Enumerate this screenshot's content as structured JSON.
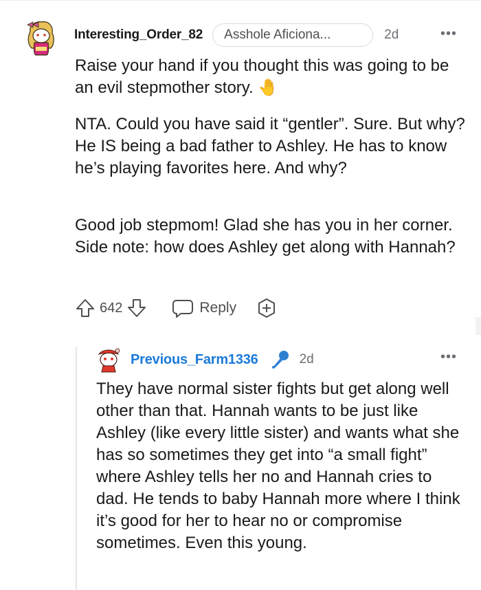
{
  "comment": {
    "username": "Interesting_Order_82",
    "flair": "Asshole Aficiona...",
    "time": "2d",
    "more_glyph": "•••",
    "paragraphs": [
      "Raise your hand if you thought this was going to be an evil stepmother story. 🤚",
      "NTA. Could you have said it “gentler”. Sure. But why? He IS being a bad father to Ashley. He has to know he’s playing favorites here. And why?",
      "Good job stepmom! Glad she has you in her corner. Side note: how does Ashley get along with Hannah?"
    ],
    "votes": "642",
    "reply_label": "Reply",
    "icons": {
      "upvote": "arrow-up-icon",
      "downvote": "arrow-down-icon",
      "reply": "speech-bubble-icon",
      "award": "award-plus-icon",
      "avatar": "snoo-avatar-icon"
    }
  },
  "reply": {
    "username": "Previous_Farm1336",
    "badge_icon": "microphone-icon",
    "time": "2d",
    "more_glyph": "•••",
    "text": "They have normal sister fights but get along well other than that. Hannah wants to be just like Ashley (like every little sister) and wants what she has so sometimes they get into “a small fight” where Ashley tells her no and Hannah cries to dad. He tends to baby Hannah more where I think it’s good for her to hear no or compromise sometimes. Even this young."
  },
  "colors": {
    "username_reply": "#1b7ad8",
    "mic_badge": "#2f7fd1",
    "text": "#1a1a1b",
    "muted": "#6b6e72"
  }
}
